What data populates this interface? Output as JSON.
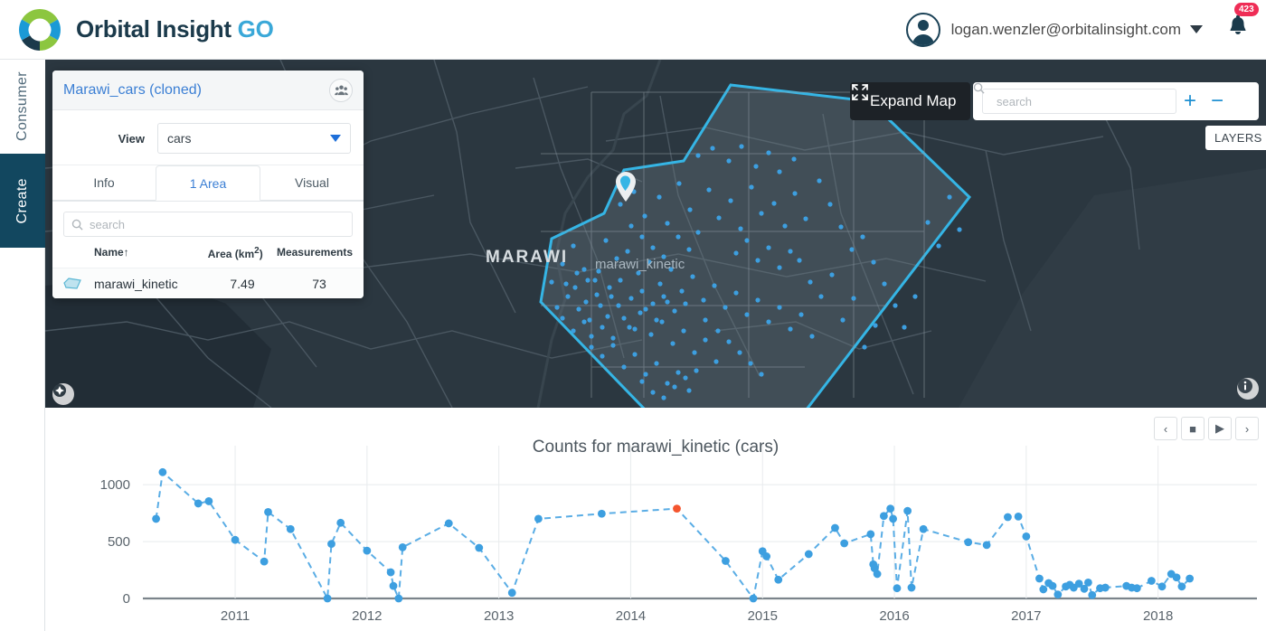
{
  "header": {
    "logo_text_main": "Orbital Insight",
    "logo_text_go": "GO",
    "user_email": "logan.wenzler@orbitalinsight.com",
    "notification_count": "423"
  },
  "sidebar": {
    "items": [
      {
        "label": "Consumer",
        "active": false
      },
      {
        "label": "Create",
        "active": true
      }
    ]
  },
  "card": {
    "title": "Marawi_cars (cloned)",
    "view_label": "View",
    "view_value": "cars",
    "view_options": [
      "cars"
    ],
    "tabs": [
      {
        "label": "Info",
        "selected": false
      },
      {
        "label": "1 Area",
        "selected": true
      },
      {
        "label": "Visual",
        "selected": false
      }
    ],
    "search_placeholder": "search",
    "table": {
      "columns": [
        "Name↑",
        "Area (km2)",
        "Measurements"
      ],
      "area_unit_base": "Area (km",
      "area_unit_sup": "2",
      "area_unit_close": ")",
      "rows": [
        {
          "name": "marawi_kinetic",
          "area": "7.49",
          "measurements": "73"
        }
      ]
    }
  },
  "map": {
    "expand_label": "Expand Map",
    "search_placeholder": "search",
    "zoom_in": "+",
    "zoom_out": "−",
    "layers_label": "LAYERS",
    "city_label": "MARAWI",
    "area_marker_label": "marawi_kinetic",
    "polygon_color": "#35b5e5",
    "point_color": "#3d9fe0",
    "background_color": "#2b3740"
  },
  "playback": {
    "prev_label": "‹",
    "stop_label": "■",
    "play_label": "▶",
    "next_label": "›"
  },
  "chart_data": {
    "type": "scatter",
    "title": "Counts for marawi_kinetic (cars)",
    "xlabel": "",
    "ylabel": "",
    "xtick_labels": [
      "2011",
      "2012",
      "2013",
      "2014",
      "2015",
      "2016",
      "2017",
      "2018"
    ],
    "ytick_labels": [
      "0",
      "500",
      "1000"
    ],
    "yticks": [
      0,
      500,
      1000
    ],
    "ylim": [
      0,
      1200
    ],
    "xlim": [
      2010.3,
      2018.75
    ],
    "grid": true,
    "line_style": "dashed",
    "series_color": "#3d9fe0",
    "highlight_color": "#f4552e",
    "highlight_point": {
      "x": 2014.35,
      "y": 790
    },
    "points": [
      [
        2010.4,
        700
      ],
      [
        2010.45,
        1110
      ],
      [
        2010.72,
        835
      ],
      [
        2010.8,
        855
      ],
      [
        2011.0,
        515
      ],
      [
        2011.22,
        325
      ],
      [
        2011.25,
        760
      ],
      [
        2011.42,
        610
      ],
      [
        2011.7,
        0
      ],
      [
        2011.73,
        480
      ],
      [
        2011.8,
        665
      ],
      [
        2012.0,
        420
      ],
      [
        2012.18,
        230
      ],
      [
        2012.2,
        110
      ],
      [
        2012.24,
        0
      ],
      [
        2012.27,
        450
      ],
      [
        2012.62,
        660
      ],
      [
        2012.85,
        445
      ],
      [
        2013.1,
        50
      ],
      [
        2013.3,
        700
      ],
      [
        2013.78,
        745
      ],
      [
        2014.35,
        790
      ],
      [
        2014.72,
        330
      ],
      [
        2014.93,
        0
      ],
      [
        2015.0,
        415
      ],
      [
        2015.03,
        370
      ],
      [
        2015.12,
        165
      ],
      [
        2015.35,
        390
      ],
      [
        2015.55,
        620
      ],
      [
        2015.62,
        485
      ],
      [
        2015.82,
        565
      ],
      [
        2015.84,
        300
      ],
      [
        2015.85,
        265
      ],
      [
        2015.87,
        215
      ],
      [
        2015.92,
        725
      ],
      [
        2015.97,
        790
      ],
      [
        2015.99,
        700
      ],
      [
        2016.02,
        90
      ],
      [
        2016.1,
        770
      ],
      [
        2016.13,
        95
      ],
      [
        2016.22,
        610
      ],
      [
        2016.56,
        495
      ],
      [
        2016.7,
        470
      ],
      [
        2016.86,
        715
      ],
      [
        2016.94,
        720
      ],
      [
        2017.0,
        545
      ],
      [
        2017.1,
        175
      ],
      [
        2017.13,
        80
      ],
      [
        2017.17,
        135
      ],
      [
        2017.2,
        110
      ],
      [
        2017.24,
        35
      ],
      [
        2017.3,
        105
      ],
      [
        2017.33,
        120
      ],
      [
        2017.36,
        95
      ],
      [
        2017.4,
        130
      ],
      [
        2017.44,
        85
      ],
      [
        2017.47,
        140
      ],
      [
        2017.5,
        30
      ],
      [
        2017.56,
        90
      ],
      [
        2017.6,
        95
      ],
      [
        2017.76,
        110
      ],
      [
        2017.8,
        95
      ],
      [
        2017.84,
        90
      ],
      [
        2017.95,
        155
      ],
      [
        2018.03,
        105
      ],
      [
        2018.1,
        215
      ],
      [
        2018.14,
        185
      ],
      [
        2018.18,
        105
      ],
      [
        2018.24,
        175
      ]
    ]
  }
}
